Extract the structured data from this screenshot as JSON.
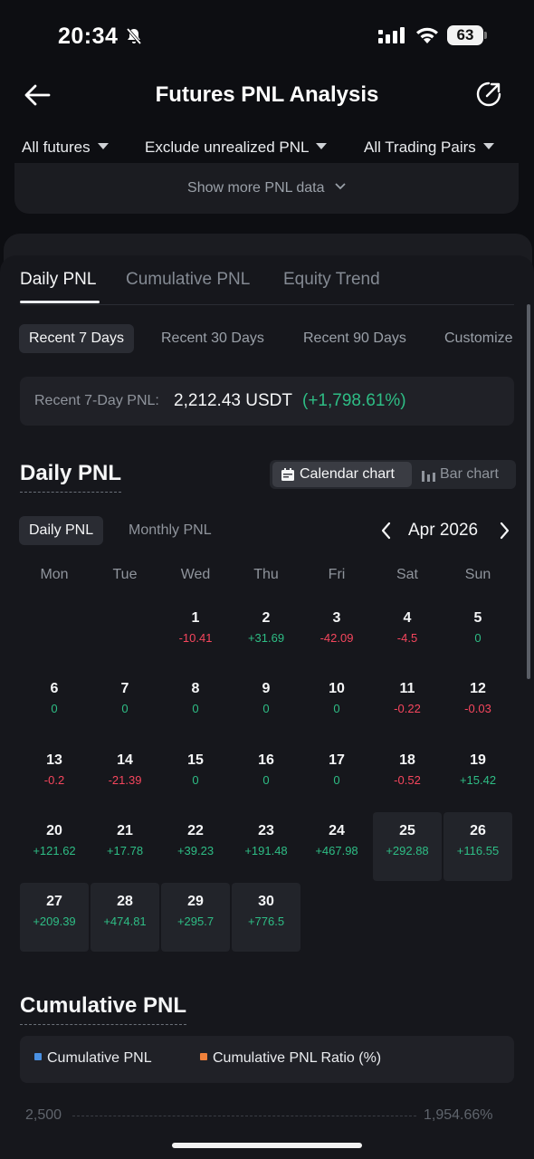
{
  "status_bar": {
    "time": "20:34",
    "battery": "63"
  },
  "header": {
    "title": "Futures PNL Analysis"
  },
  "filters": [
    {
      "label": "All futures"
    },
    {
      "label": "Exclude unrealized PNL"
    },
    {
      "label": "All Trading Pairs"
    }
  ],
  "summary": {
    "show_more": "Show more PNL data"
  },
  "tabs": [
    {
      "label": "Daily PNL",
      "active": true
    },
    {
      "label": "Cumulative PNL",
      "active": false
    },
    {
      "label": "Equity Trend",
      "active": false
    }
  ],
  "ranges": [
    {
      "label": "Recent 7 Days",
      "active": true
    },
    {
      "label": "Recent 30 Days",
      "active": false
    },
    {
      "label": "Recent 90 Days",
      "active": false
    },
    {
      "label": "Customize",
      "active": false
    }
  ],
  "recent": {
    "label": "Recent 7-Day PNL:",
    "value": "2,212.43 USDT",
    "pct": "(+1,798.61%)"
  },
  "daily_section": {
    "title": "Daily PNL",
    "chart_switch": {
      "calendar": "Calendar chart",
      "bar": "Bar chart"
    },
    "sub_tabs": {
      "daily": "Daily PNL",
      "monthly": "Monthly PNL"
    },
    "month": "Apr 2026",
    "weekdays": [
      "Mon",
      "Tue",
      "Wed",
      "Thu",
      "Fri",
      "Sat",
      "Sun"
    ],
    "days": [
      {
        "day": "1",
        "pnl": "-10.41",
        "sign": "neg"
      },
      {
        "day": "2",
        "pnl": "+31.69",
        "sign": "pos"
      },
      {
        "day": "3",
        "pnl": "-42.09",
        "sign": "neg"
      },
      {
        "day": "4",
        "pnl": "-4.5",
        "sign": "neg"
      },
      {
        "day": "5",
        "pnl": "0",
        "sign": "pos"
      },
      {
        "day": "6",
        "pnl": "0",
        "sign": "pos"
      },
      {
        "day": "7",
        "pnl": "0",
        "sign": "pos"
      },
      {
        "day": "8",
        "pnl": "0",
        "sign": "pos"
      },
      {
        "day": "9",
        "pnl": "0",
        "sign": "pos"
      },
      {
        "day": "10",
        "pnl": "0",
        "sign": "pos"
      },
      {
        "day": "11",
        "pnl": "-0.22",
        "sign": "neg"
      },
      {
        "day": "12",
        "pnl": "-0.03",
        "sign": "neg"
      },
      {
        "day": "13",
        "pnl": "-0.2",
        "sign": "neg"
      },
      {
        "day": "14",
        "pnl": "-21.39",
        "sign": "neg"
      },
      {
        "day": "15",
        "pnl": "0",
        "sign": "pos"
      },
      {
        "day": "16",
        "pnl": "0",
        "sign": "pos"
      },
      {
        "day": "17",
        "pnl": "0",
        "sign": "pos"
      },
      {
        "day": "18",
        "pnl": "-0.52",
        "sign": "neg"
      },
      {
        "day": "19",
        "pnl": "+15.42",
        "sign": "pos"
      },
      {
        "day": "20",
        "pnl": "+121.62",
        "sign": "pos"
      },
      {
        "day": "21",
        "pnl": "+17.78",
        "sign": "pos"
      },
      {
        "day": "22",
        "pnl": "+39.23",
        "sign": "pos"
      },
      {
        "day": "23",
        "pnl": "+191.48",
        "sign": "pos"
      },
      {
        "day": "24",
        "pnl": "+467.98",
        "sign": "pos"
      },
      {
        "day": "25",
        "pnl": "+292.88",
        "sign": "pos",
        "highlight": true
      },
      {
        "day": "26",
        "pnl": "+116.55",
        "sign": "pos",
        "highlight": true
      },
      {
        "day": "27",
        "pnl": "+209.39",
        "sign": "pos",
        "highlight": true
      },
      {
        "day": "28",
        "pnl": "+474.81",
        "sign": "pos",
        "highlight": true
      },
      {
        "day": "29",
        "pnl": "+295.7",
        "sign": "pos",
        "highlight": true
      },
      {
        "day": "30",
        "pnl": "+776.5",
        "sign": "pos",
        "highlight": true
      }
    ]
  },
  "cumulative_section": {
    "title": "Cumulative PNL",
    "legend": [
      {
        "label": "Cumulative PNL",
        "color": "#4a90e2"
      },
      {
        "label": "Cumulative PNL Ratio (%)",
        "color": "#f0813b"
      }
    ],
    "axis_left": "2,500",
    "axis_right": "1,954.66%"
  },
  "colors": {
    "positive": "#2ebd85",
    "negative": "#f6465d",
    "background": "#0d0e12"
  }
}
